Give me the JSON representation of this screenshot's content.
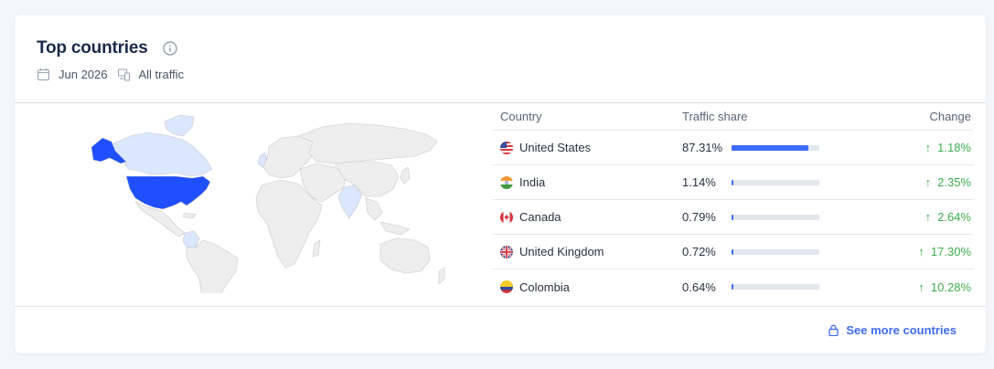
{
  "widget": {
    "title": "Top countries",
    "date_label": "Jun 2026",
    "traffic_label": "All traffic",
    "see_more_label": "See more countries"
  },
  "table": {
    "headers": {
      "country": "Country",
      "share": "Traffic share",
      "change": "Change"
    },
    "rows": [
      {
        "country": "United States",
        "share": "87.31%",
        "share_value": 87.31,
        "change": "1.18%",
        "flag": "us-flag-icon"
      },
      {
        "country": "India",
        "share": "1.14%",
        "share_value": 1.14,
        "change": "2.35%",
        "flag": "india-flag-icon"
      },
      {
        "country": "Canada",
        "share": "0.79%",
        "share_value": 0.79,
        "change": "2.64%",
        "flag": "canada-flag-icon"
      },
      {
        "country": "United Kingdom",
        "share": "0.72%",
        "share_value": 0.72,
        "change": "17.30%",
        "flag": "uk-flag-icon"
      },
      {
        "country": "Colombia",
        "share": "0.64%",
        "share_value": 0.64,
        "change": "10.28%",
        "flag": "colombia-flag-icon"
      }
    ]
  },
  "colors": {
    "accent": "#3e6bff",
    "positive": "#3cae4b",
    "map_highlight": "#1f4fff",
    "map_light": "#dbe6ff",
    "map_base": "#eeeeee"
  }
}
